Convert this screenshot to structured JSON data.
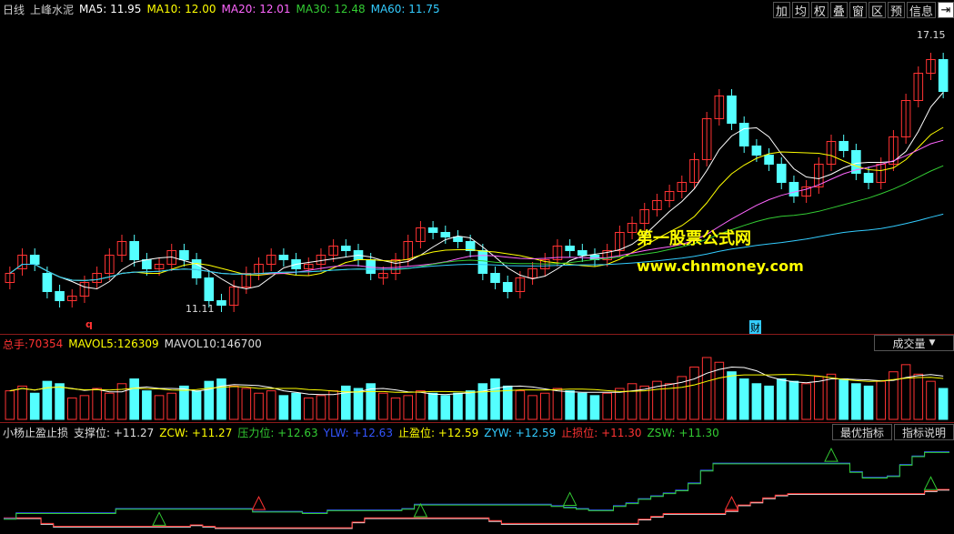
{
  "header": {
    "period": "日线",
    "stock": "上峰水泥",
    "ma": [
      {
        "label": "MA5:",
        "value": "11.95",
        "color": "#ffffff"
      },
      {
        "label": "MA10:",
        "value": "12.00",
        "color": "#ffff00"
      },
      {
        "label": "MA20:",
        "value": "12.01",
        "color": "#ff66ff"
      },
      {
        "label": "MA30:",
        "value": "12.48",
        "color": "#33cc33"
      },
      {
        "label": "MA60:",
        "value": "11.75",
        "color": "#33ccff"
      }
    ]
  },
  "toolbar": [
    {
      "label": "加",
      "icon": "add-icon"
    },
    {
      "label": "均",
      "icon": "average-icon"
    },
    {
      "label": "权",
      "icon": "weight-icon"
    },
    {
      "label": "叠",
      "icon": "overlay-icon"
    },
    {
      "label": "窗",
      "icon": "window-icon"
    },
    {
      "label": "区",
      "icon": "range-icon"
    },
    {
      "label": "预",
      "icon": "forecast-icon"
    },
    {
      "label": "信息",
      "icon": "info-icon"
    },
    {
      "label": "⇥",
      "icon": "collapse-icon"
    }
  ],
  "price_annotations": {
    "high": "17.15",
    "low": "11.11",
    "mark_q": "q",
    "mark_cai": "财"
  },
  "watermark": {
    "line1": "第一股票公式网",
    "line2": "www.chnmoney.com"
  },
  "volume": {
    "total_label": "总手:",
    "total_value": "70354",
    "mavol5_label": "MAVOL5:",
    "mavol5_value": "126309",
    "mavol10_label": "MAVOL10:",
    "mavol10_value": "146700",
    "selector": "成交量"
  },
  "indicator": {
    "name": "小杨止盈止损",
    "items": [
      {
        "label": "支撑位:",
        "value": "+11.27",
        "color": "#dddddd"
      },
      {
        "label": "ZCW:",
        "value": "+11.27",
        "color": "#ffff00"
      },
      {
        "label": "压力位:",
        "value": "+12.63",
        "color": "#33cc33"
      },
      {
        "label": "YLW:",
        "value": "+12.63",
        "color": "#3355ff"
      },
      {
        "label": "止盈位:",
        "value": "+12.59",
        "color": "#ffff00"
      },
      {
        "label": "ZYW:",
        "value": "+12.59",
        "color": "#33ccff"
      },
      {
        "label": "止损位:",
        "value": "+11.30",
        "color": "#ff3333"
      },
      {
        "label": "ZSW:",
        "value": "+11.30",
        "color": "#33cc33"
      }
    ],
    "btn_best": "最优指标",
    "btn_help": "指标说明"
  },
  "colors": {
    "up": "#ff3333",
    "down": "#54ffff",
    "ma5": "#ffffff",
    "ma10": "#ffff00",
    "ma20": "#ff66ff",
    "ma30": "#33cc33",
    "ma60": "#33ccff"
  },
  "chart_data": {
    "type": "candlestick",
    "y_range": [
      11.11,
      17.15
    ],
    "closes": [
      11.9,
      12.3,
      12.1,
      11.5,
      11.3,
      11.4,
      11.7,
      11.9,
      12.3,
      12.6,
      12.2,
      12.0,
      12.1,
      12.4,
      12.2,
      11.8,
      11.3,
      11.2,
      11.6,
      11.9,
      12.1,
      12.3,
      12.2,
      12.0,
      12.1,
      12.3,
      12.5,
      12.4,
      12.2,
      11.9,
      11.9,
      12.2,
      12.6,
      12.9,
      12.8,
      12.7,
      12.6,
      12.4,
      11.9,
      11.7,
      11.5,
      11.8,
      12.0,
      12.2,
      12.5,
      12.4,
      12.3,
      12.2,
      12.4,
      12.8,
      13.0,
      13.3,
      13.5,
      13.7,
      13.9,
      14.4,
      15.3,
      15.8,
      15.2,
      14.7,
      14.5,
      14.3,
      13.9,
      13.6,
      13.8,
      14.3,
      14.8,
      14.6,
      14.1,
      13.9,
      14.3,
      14.9,
      15.7,
      16.3,
      16.6,
      15.9
    ],
    "opens": [
      11.7,
      12.0,
      12.3,
      11.9,
      11.5,
      11.3,
      11.4,
      11.7,
      11.9,
      12.3,
      12.6,
      12.2,
      12.0,
      12.1,
      12.4,
      12.2,
      11.8,
      11.3,
      11.2,
      11.6,
      11.9,
      12.1,
      12.3,
      12.2,
      12.0,
      12.1,
      12.3,
      12.5,
      12.4,
      12.2,
      11.8,
      11.9,
      12.2,
      12.6,
      12.9,
      12.8,
      12.7,
      12.6,
      12.4,
      11.9,
      11.7,
      11.5,
      11.8,
      12.0,
      12.2,
      12.5,
      12.4,
      12.3,
      12.2,
      12.4,
      12.8,
      13.0,
      13.3,
      13.5,
      13.7,
      13.9,
      14.4,
      15.3,
      15.8,
      15.2,
      14.7,
      14.5,
      14.3,
      13.9,
      13.6,
      13.8,
      14.3,
      14.8,
      14.6,
      14.1,
      13.9,
      14.3,
      14.9,
      15.7,
      16.3,
      16.6
    ],
    "volumes": [
      120,
      140,
      110,
      160,
      150,
      90,
      100,
      130,
      110,
      150,
      170,
      120,
      100,
      110,
      140,
      120,
      160,
      170,
      140,
      130,
      110,
      120,
      100,
      110,
      90,
      100,
      120,
      140,
      130,
      150,
      110,
      90,
      100,
      120,
      110,
      100,
      110,
      120,
      150,
      170,
      140,
      120,
      100,
      110,
      130,
      120,
      110,
      100,
      110,
      130,
      150,
      140,
      160,
      150,
      180,
      220,
      260,
      240,
      200,
      170,
      150,
      140,
      170,
      160,
      150,
      180,
      190,
      170,
      150,
      140,
      160,
      200,
      230,
      190,
      160,
      130
    ]
  }
}
